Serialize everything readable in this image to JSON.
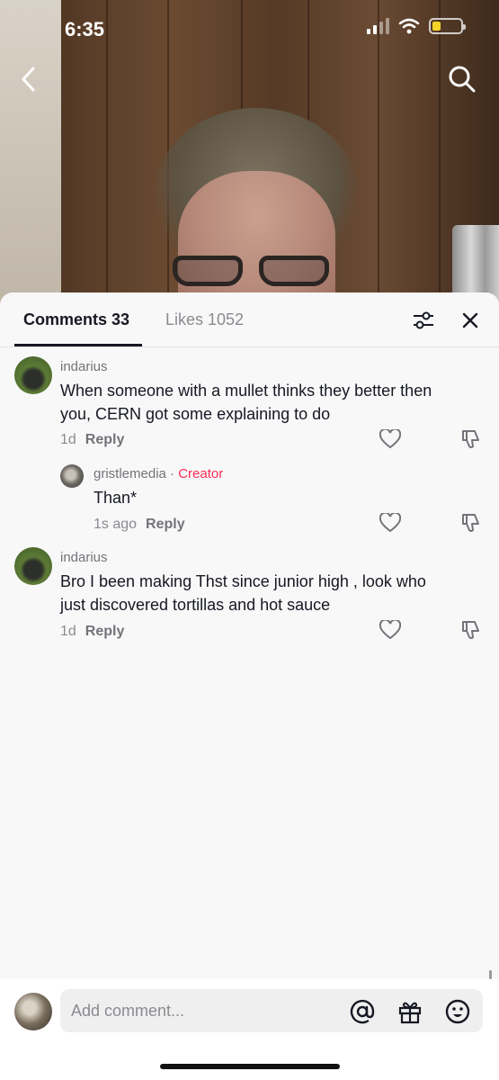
{
  "status_bar": {
    "time": "6:35"
  },
  "icons": {
    "back": "chevron-left-icon",
    "search": "search-icon",
    "filter": "sliders-icon",
    "close": "close-icon",
    "like": "heart-icon",
    "dislike": "thumbs-down-icon",
    "mention": "at-icon",
    "gift": "gift-icon",
    "emoji": "emoji-icon"
  },
  "colors": {
    "accent": "#fe2c55",
    "text": "#161823",
    "muted": "#8a8b91"
  },
  "tabs": [
    {
      "label": "Comments 33",
      "active": true
    },
    {
      "label": "Likes 1052",
      "active": false
    }
  ],
  "comments": [
    {
      "username": "indarius",
      "text": "When someone with a mullet thinks they better then you, CERN got some explaining to do",
      "time": "1d",
      "reply_label": "Reply"
    },
    {
      "username": "gristlemedia",
      "separator": "·",
      "badge": "Creator",
      "text": "Than*",
      "time": "1s ago",
      "reply_label": "Reply"
    },
    {
      "username": "indarius",
      "text": "Bro I been making Thst since junior high , look who just discovered tortillas and hot sauce",
      "time": "1d",
      "reply_label": "Reply"
    }
  ],
  "composer": {
    "placeholder": "Add comment..."
  }
}
